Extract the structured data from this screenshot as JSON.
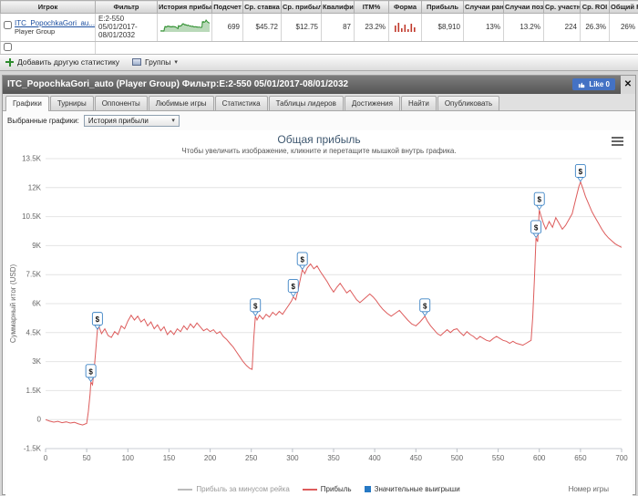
{
  "colors": {
    "like-blue": "#4472c4",
    "link-blue": "#1c4fa0",
    "profit-red": "#dd5c5c",
    "marker-blue": "#3b82c4",
    "spark-green": "#2f8f2f",
    "win-blue": "#2779c4"
  },
  "table": {
    "headers": [
      "Игрок",
      "Фильтр",
      "История прибыли",
      "Подсчет",
      "Ср. ставка",
      "Ср. прибыль",
      "Квалифи",
      "ITM%",
      "Форма",
      "Прибыль",
      "Случаи ранн",
      "Случаи позд",
      "Ср. участни",
      "Ср. ROI",
      "Общий ROI"
    ],
    "row": {
      "player_name": "ITC_PopochkaGori_au...",
      "player_type": "Player Group",
      "filter": "E:2-550 05/01/2017- 08/01/2032",
      "count": "699",
      "avg_stake": "$45.72",
      "avg_profit": "$12.75",
      "qualified": "87",
      "itm_pct": "23.2%",
      "profit": "$8,910",
      "early_pct": "13%",
      "late_pct": "13.2%",
      "avg_entrants": "224",
      "avg_roi": "26.3%",
      "total_roi": "26%"
    },
    "form_bars": [
      7,
      10,
      4,
      8,
      3,
      9,
      5
    ]
  },
  "toolbar": {
    "add_stat_label": "Добавить другую статистику",
    "groups_label": "Группы"
  },
  "icons": {
    "caret_down": "▾",
    "close": "✕"
  },
  "panel": {
    "title": "ITC_PopochkaGori_auto (Player Group) Фильтр:E:2-550 05/01/2017-08/01/2032",
    "like_label": "Like 0",
    "tabs": [
      {
        "label": "Графики"
      },
      {
        "label": "Турниры"
      },
      {
        "label": "Оппоненты"
      },
      {
        "label": "Любимые игры"
      },
      {
        "label": "Статистика"
      },
      {
        "label": "Таблицы лидеров"
      },
      {
        "label": "Достижения"
      },
      {
        "label": "Найти"
      },
      {
        "label": "Опубликовать"
      }
    ],
    "selected_charts_label": "Выбранные графики:",
    "selected_chart": "История прибыли"
  },
  "chart_data": {
    "type": "line",
    "title": "Общая прибыль",
    "subtitle": "Чтобы увеличить изображение, кликните и перетащите мышкой внутрь графика.",
    "xlabel": "Номер игры",
    "ylabel": "Суммарный итог (USD)",
    "xlim": [
      0,
      700
    ],
    "ylim": [
      -1500,
      13500
    ],
    "grid": "horizontal",
    "legend_position": "bottom",
    "x_ticks": [
      0,
      50,
      100,
      150,
      200,
      250,
      300,
      350,
      400,
      450,
      500,
      550,
      600,
      650,
      700
    ],
    "y_ticks": [
      {
        "value": -1500,
        "label": "-1.5K"
      },
      {
        "value": 0,
        "label": "0"
      },
      {
        "value": 1500,
        "label": "1.5K"
      },
      {
        "value": 3000,
        "label": "3K"
      },
      {
        "value": 4500,
        "label": "4.5K"
      },
      {
        "value": 6000,
        "label": "6K"
      },
      {
        "value": 7500,
        "label": "7.5K"
      },
      {
        "value": 9000,
        "label": "9K"
      },
      {
        "value": 10500,
        "label": "10.5K"
      },
      {
        "value": 12000,
        "label": "12K"
      },
      {
        "value": 13500,
        "label": "13.5K"
      }
    ],
    "legend": [
      "Прибыль за минусом рейка",
      "Прибыль",
      "Значительные выигрыши"
    ],
    "series": [
      {
        "name": "Прибыль за минусом рейка",
        "color": "#999999",
        "visible": false,
        "points": []
      },
      {
        "name": "Прибыль",
        "color": "#dd5c5c",
        "points": [
          [
            0,
            0
          ],
          [
            5,
            -80
          ],
          [
            10,
            -130
          ],
          [
            15,
            -90
          ],
          [
            20,
            -160
          ],
          [
            25,
            -120
          ],
          [
            30,
            -180
          ],
          [
            35,
            -140
          ],
          [
            40,
            -220
          ],
          [
            45,
            -280
          ],
          [
            50,
            -200
          ],
          [
            52,
            400
          ],
          [
            54,
            1300
          ],
          [
            55,
            1950
          ],
          [
            57,
            1800
          ],
          [
            59,
            2600
          ],
          [
            61,
            3600
          ],
          [
            63,
            4650
          ],
          [
            65,
            4800
          ],
          [
            68,
            4450
          ],
          [
            72,
            4700
          ],
          [
            76,
            4350
          ],
          [
            80,
            4250
          ],
          [
            84,
            4550
          ],
          [
            88,
            4400
          ],
          [
            92,
            4850
          ],
          [
            96,
            4700
          ],
          [
            100,
            5100
          ],
          [
            104,
            5400
          ],
          [
            108,
            5150
          ],
          [
            112,
            5350
          ],
          [
            116,
            5050
          ],
          [
            120,
            5200
          ],
          [
            124,
            4850
          ],
          [
            128,
            5050
          ],
          [
            132,
            4700
          ],
          [
            136,
            4900
          ],
          [
            140,
            4600
          ],
          [
            144,
            4800
          ],
          [
            148,
            4400
          ],
          [
            152,
            4600
          ],
          [
            156,
            4400
          ],
          [
            160,
            4700
          ],
          [
            164,
            4550
          ],
          [
            168,
            4850
          ],
          [
            172,
            4650
          ],
          [
            176,
            4950
          ],
          [
            180,
            4750
          ],
          [
            184,
            5000
          ],
          [
            188,
            4800
          ],
          [
            192,
            4600
          ],
          [
            196,
            4700
          ],
          [
            200,
            4550
          ],
          [
            204,
            4650
          ],
          [
            208,
            4450
          ],
          [
            212,
            4550
          ],
          [
            216,
            4300
          ],
          [
            220,
            4150
          ],
          [
            224,
            3950
          ],
          [
            228,
            3750
          ],
          [
            232,
            3500
          ],
          [
            236,
            3250
          ],
          [
            240,
            3000
          ],
          [
            244,
            2800
          ],
          [
            248,
            2650
          ],
          [
            251,
            2600
          ],
          [
            253,
            4200
          ],
          [
            255,
            5350
          ],
          [
            257,
            5150
          ],
          [
            260,
            5400
          ],
          [
            264,
            5200
          ],
          [
            268,
            5450
          ],
          [
            272,
            5300
          ],
          [
            276,
            5550
          ],
          [
            280,
            5400
          ],
          [
            284,
            5600
          ],
          [
            288,
            5450
          ],
          [
            292,
            5700
          ],
          [
            296,
            5950
          ],
          [
            299,
            6150
          ],
          [
            301,
            6350
          ],
          [
            304,
            6200
          ],
          [
            307,
            6750
          ],
          [
            310,
            7350
          ],
          [
            312,
            7750
          ],
          [
            315,
            7550
          ],
          [
            318,
            7850
          ],
          [
            322,
            8050
          ],
          [
            326,
            7800
          ],
          [
            330,
            7950
          ],
          [
            334,
            7650
          ],
          [
            338,
            7400
          ],
          [
            342,
            7150
          ],
          [
            346,
            6850
          ],
          [
            350,
            6600
          ],
          [
            354,
            6850
          ],
          [
            358,
            7050
          ],
          [
            362,
            6800
          ],
          [
            366,
            6550
          ],
          [
            370,
            6700
          ],
          [
            374,
            6450
          ],
          [
            378,
            6200
          ],
          [
            382,
            6050
          ],
          [
            386,
            6200
          ],
          [
            390,
            6350
          ],
          [
            394,
            6500
          ],
          [
            398,
            6350
          ],
          [
            402,
            6150
          ],
          [
            406,
            5900
          ],
          [
            410,
            5700
          ],
          [
            415,
            5500
          ],
          [
            420,
            5350
          ],
          [
            425,
            5500
          ],
          [
            430,
            5650
          ],
          [
            435,
            5400
          ],
          [
            440,
            5150
          ],
          [
            445,
            4950
          ],
          [
            450,
            4850
          ],
          [
            455,
            5050
          ],
          [
            458,
            5200
          ],
          [
            461,
            5350
          ],
          [
            464,
            5100
          ],
          [
            468,
            4850
          ],
          [
            472,
            4650
          ],
          [
            476,
            4450
          ],
          [
            480,
            4350
          ],
          [
            484,
            4500
          ],
          [
            488,
            4650
          ],
          [
            492,
            4500
          ],
          [
            496,
            4650
          ],
          [
            500,
            4700
          ],
          [
            504,
            4500
          ],
          [
            508,
            4350
          ],
          [
            512,
            4550
          ],
          [
            516,
            4400
          ],
          [
            520,
            4300
          ],
          [
            524,
            4150
          ],
          [
            528,
            4300
          ],
          [
            532,
            4200
          ],
          [
            536,
            4100
          ],
          [
            540,
            4050
          ],
          [
            544,
            4200
          ],
          [
            548,
            4300
          ],
          [
            552,
            4200
          ],
          [
            556,
            4100
          ],
          [
            560,
            4050
          ],
          [
            564,
            3950
          ],
          [
            568,
            4050
          ],
          [
            572,
            3950
          ],
          [
            576,
            3900
          ],
          [
            580,
            3850
          ],
          [
            584,
            3950
          ],
          [
            588,
            4050
          ],
          [
            590,
            4100
          ],
          [
            592,
            5300
          ],
          [
            594,
            7200
          ],
          [
            596,
            9400
          ],
          [
            598,
            9200
          ],
          [
            600,
            10850
          ],
          [
            602,
            10550
          ],
          [
            605,
            10150
          ],
          [
            608,
            9850
          ],
          [
            612,
            10250
          ],
          [
            616,
            9950
          ],
          [
            620,
            10450
          ],
          [
            624,
            10150
          ],
          [
            628,
            9850
          ],
          [
            632,
            10050
          ],
          [
            636,
            10350
          ],
          [
            640,
            10650
          ],
          [
            644,
            11350
          ],
          [
            648,
            12050
          ],
          [
            650,
            12300
          ],
          [
            653,
            11950
          ],
          [
            656,
            11550
          ],
          [
            660,
            11150
          ],
          [
            664,
            10750
          ],
          [
            668,
            10450
          ],
          [
            672,
            10150
          ],
          [
            676,
            9850
          ],
          [
            680,
            9600
          ],
          [
            684,
            9400
          ],
          [
            688,
            9250
          ],
          [
            692,
            9100
          ],
          [
            696,
            9000
          ],
          [
            700,
            8910
          ]
        ]
      }
    ],
    "markers": {
      "name": "Значительные выигрыши",
      "color": "#3b82c4",
      "symbol": "$",
      "points": [
        [
          55,
          1950
        ],
        [
          63,
          4650
        ],
        [
          255,
          5350
        ],
        [
          301,
          6350
        ],
        [
          312,
          7750
        ],
        [
          461,
          5350
        ],
        [
          596,
          9400
        ],
        [
          600,
          10850
        ],
        [
          650,
          12300
        ]
      ]
    }
  }
}
